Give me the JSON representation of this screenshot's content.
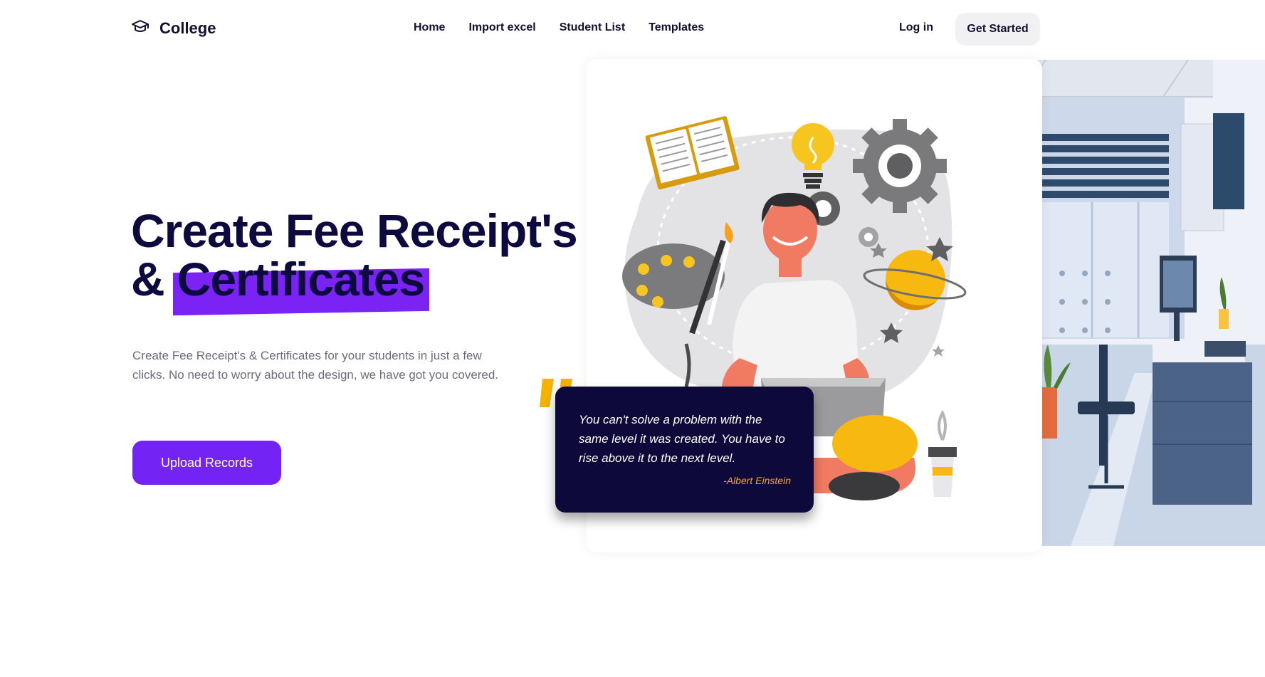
{
  "header": {
    "logo_icon": "graduation-cap-icon",
    "brand": "College",
    "nav": [
      {
        "label": "Home"
      },
      {
        "label": "Import excel"
      },
      {
        "label": "Student List"
      },
      {
        "label": "Templates"
      }
    ],
    "login_label": "Log in",
    "cta_label": "Get Started"
  },
  "hero": {
    "title_line1": "Create Fee Receipt's",
    "title_amp": "&",
    "title_highlight": "Certificates",
    "description": "Create Fee Receipt's & Certificates for your students in just a few clicks. No need to worry about the design, we have got you covered.",
    "button_label": "Upload Records"
  },
  "quote": {
    "text": "You can't solve a problem with the same level it was created. You have to rise above it to the next level.",
    "author": "-Albert Einstein"
  },
  "colors": {
    "accent": "#7423f5",
    "dark": "#0d0a3b",
    "quote_author": "#f5a623"
  }
}
